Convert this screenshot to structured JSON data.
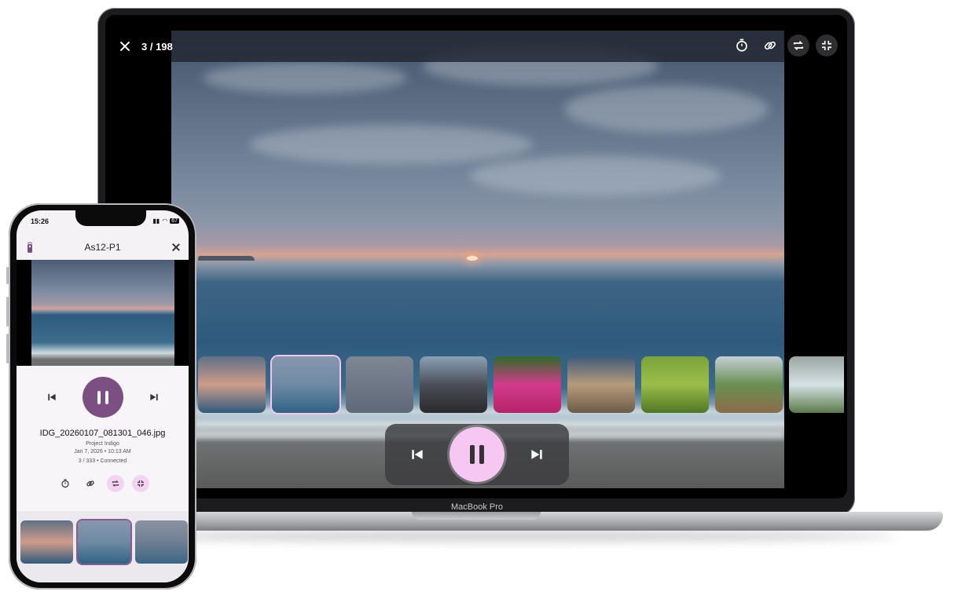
{
  "laptop": {
    "counter": "3 / 198",
    "device_label": "MacBook Pro",
    "topbar_icons": [
      "timer-icon",
      "link-icon",
      "repeat-icon",
      "collapse-icon"
    ],
    "thumbnails": [
      {
        "name": "sunset-beach",
        "colors": [
          "#5f6f86",
          "#cf9c8a",
          "#2f5a7d"
        ]
      },
      {
        "name": "sunset-wide",
        "colors": [
          "#8797ad",
          "#6f8aa4",
          "#2f6384"
        ],
        "active": true
      },
      {
        "name": "grey-sea",
        "colors": [
          "#7e8693",
          "#6f7887",
          "#5e6878"
        ]
      },
      {
        "name": "rocky-shore",
        "colors": [
          "#8ba0b6",
          "#4b4f57",
          "#2a2b2d"
        ]
      },
      {
        "name": "pink-flowers",
        "colors": [
          "#2f6b2a",
          "#d23b8b",
          "#b5236a"
        ]
      },
      {
        "name": "desk-room",
        "colors": [
          "#3f5a7a",
          "#b59b7a",
          "#6c5b49"
        ]
      },
      {
        "name": "green-leaves",
        "colors": [
          "#7ca33a",
          "#9bbd4a",
          "#4f7626"
        ]
      },
      {
        "name": "hill-flowers",
        "colors": [
          "#c4cfd6",
          "#6a8f52",
          "#8b6c4a"
        ]
      },
      {
        "name": "waterfall",
        "colors": [
          "#9aa6a0",
          "#d6e1e6",
          "#5c7a4a"
        ]
      }
    ]
  },
  "phone": {
    "status_time": "15:26",
    "battery": "67",
    "title": "As12-P1",
    "filename": "IDG_20260107_081301_046.jpg",
    "project": "Project Indigo",
    "date": "Jan 7, 2026 • 10:13 AM",
    "status": "3 / 333 • Connected",
    "thumbnails": [
      {
        "name": "sunset-beach",
        "colors": [
          "#5f6f86",
          "#cf9c8a",
          "#2f5a7d"
        ]
      },
      {
        "name": "sunset-wide",
        "colors": [
          "#8797ad",
          "#6f8aa4",
          "#2f6384"
        ],
        "active": true
      },
      {
        "name": "grey-sea",
        "colors": [
          "#8a93a3",
          "#6f7f93",
          "#3c6584"
        ]
      }
    ]
  },
  "colors": {
    "accent_pink": "#f6c7f3",
    "accent_purple": "#7b4f82"
  }
}
